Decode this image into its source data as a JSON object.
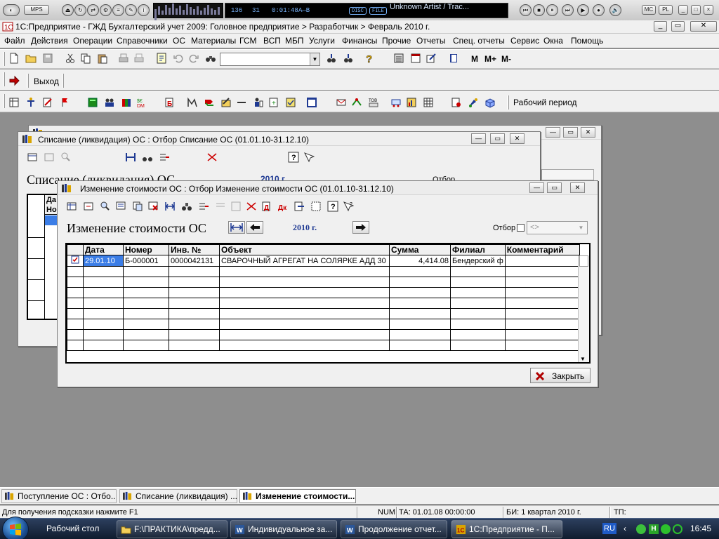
{
  "media_player": {
    "buttons_left": [
      "MPS"
    ],
    "lcd": {
      "counter_a": "136",
      "counter_b": "31",
      "time": "0:01:48",
      "mode": "A⇔B",
      "disc": "DISC",
      "file": "FILE",
      "track": "Unknown Artist / Trac..."
    },
    "buttons_right": [
      "MC",
      "PL"
    ]
  },
  "app": {
    "title": "1С:Предприятие - ГЖД Бухгалтерский учет 2009: Головное предприятие > Разработчик > Февраль 2010 г."
  },
  "menu": [
    "Файл",
    "Действия",
    "Операции",
    "Справочники",
    "ОС",
    "Материалы",
    "ГСМ",
    "ВСП",
    "МБП",
    "Услуги",
    "Финансы",
    "Прочие",
    "Отчеты",
    "Спец. отчеты",
    "Сервис",
    "Окна",
    "Помощь"
  ],
  "toolbar_main": {
    "calc_m": "M",
    "calc_mplus": "M+",
    "calc_mminus": "M-"
  },
  "toolbar_exit": {
    "label": "Выход"
  },
  "toolbar_ops": {
    "period_label": "Рабочий период"
  },
  "windows": {
    "back3": {
      "title": ""
    },
    "back2": {
      "title": "Списание (ликвидация) ОС : Отбор Списание ОС (01.01.10-31.12.10)",
      "heading": "Списание (ликвидация) ОС",
      "year": "2010 г.",
      "filter_label": "Отбор",
      "columns": [
        "Да",
        "Но"
      ]
    },
    "front": {
      "title": "Изменение стоимости ОС : Отбор Изменение стоимости ОС (01.01.10-31.12.10)",
      "heading": "Изменение стоимости ОС",
      "year": "2010 г.",
      "filter_label": "Отбор",
      "filter_value": "<>",
      "columns": [
        "Дата",
        "Номер",
        "Инв. №",
        "Объект",
        "Сумма",
        "Филиал",
        "Комментарий"
      ],
      "rows": [
        {
          "date": "29.01.10",
          "number": "Б-000001",
          "inv": "0000042131",
          "object": "СВАРОЧНЫЙ АГРЕГАТ НА СОЛЯРКЕ АДД 30",
          "sum": "4,414.08",
          "branch": "Бендерский ф",
          "comment": ""
        }
      ],
      "close_label": "Закрыть"
    }
  },
  "switcher": [
    "Поступление ОС : Отбо...",
    "Списание (ликвидация) ...",
    "Изменение стоимости..."
  ],
  "status": {
    "hint": "Для получения подсказки нажмите F1",
    "num": "NUM",
    "ta": "ТА: 01.01.08  00:00:00",
    "bi": "БИ: 1 квартал 2010 г.",
    "tp": "ТП:"
  },
  "taskbar": {
    "items": [
      "Рабочий стол",
      "F:\\ПРАКТИКА\\предд...",
      "Индивидуальное за...",
      "Продолжение отчет...",
      "1С:Предприятие - П..."
    ],
    "lang": "RU",
    "clock": "16:45"
  },
  "colors": {
    "accent_blue": "#1f3a93",
    "selection": "#3a6ee8",
    "row_date_bg": "#3b7de6"
  }
}
